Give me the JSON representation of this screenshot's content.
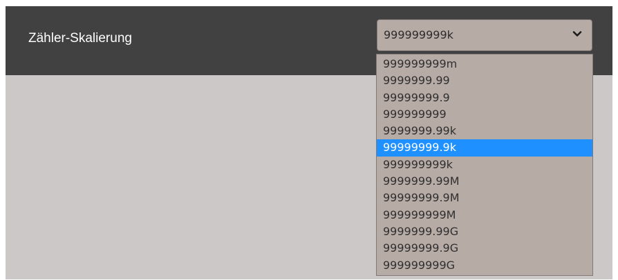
{
  "setting": {
    "label": "Zähler-Skalierung",
    "selected_value": "999999999k",
    "icon": "chevron-down-icon"
  },
  "dropdown": {
    "highlighted_index": 5,
    "highlight_color": "#1f90ff",
    "options": [
      "999999999m",
      "9999999.99",
      "99999999.9",
      "999999999",
      "9999999.99k",
      "99999999.9k",
      "999999999k",
      "9999999.99M",
      "99999999.9M",
      "999999999M",
      "9999999.99G",
      "99999999.9G",
      "999999999G"
    ]
  },
  "colors": {
    "header_bg": "#414141",
    "page_bg": "#cbc8c7",
    "select_bg": "#b7aba6"
  }
}
